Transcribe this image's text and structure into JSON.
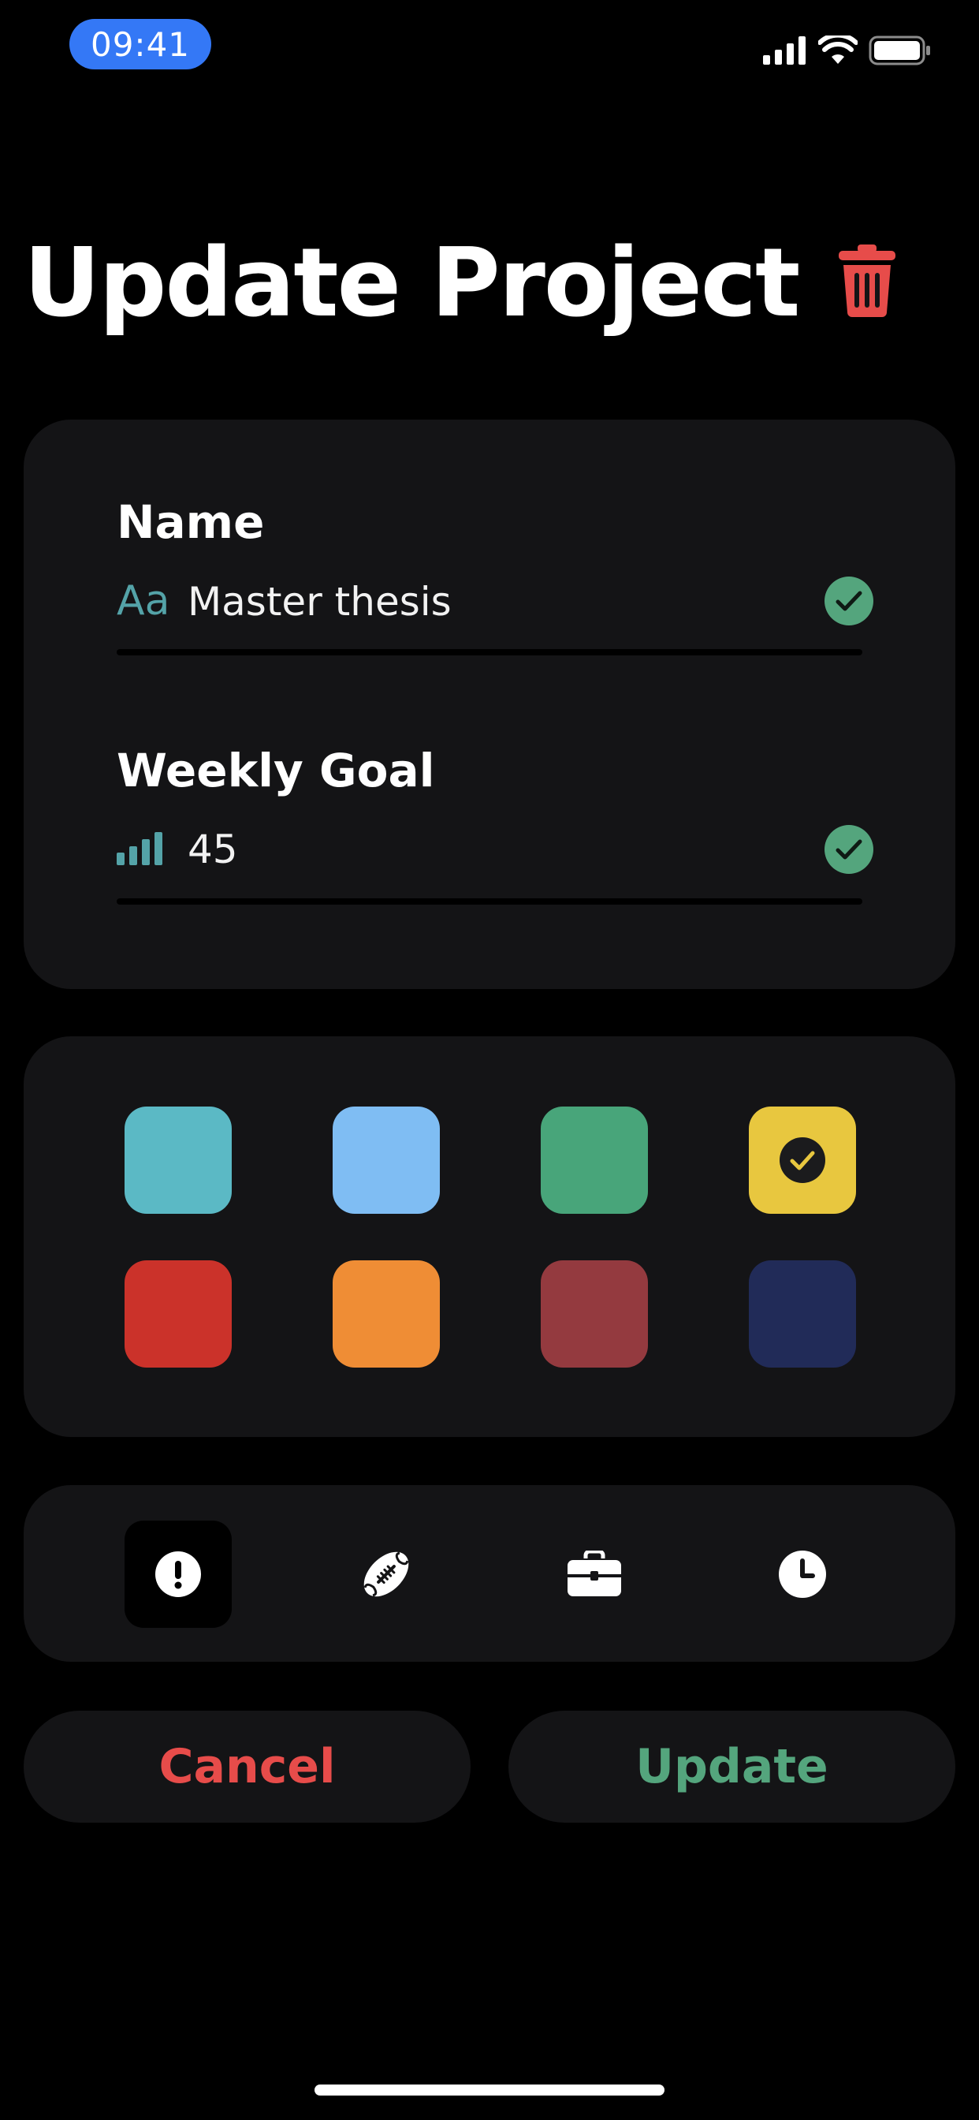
{
  "status_bar": {
    "time": "09:41",
    "signal_icon": "cellular-signal-icon",
    "wifi_icon": "wifi-icon",
    "battery_icon": "battery-icon"
  },
  "header": {
    "title": "Update Project",
    "delete_icon": "trash-icon"
  },
  "form": {
    "name": {
      "label": "Name",
      "icon": "text-aa-icon",
      "icon_text": "Aa",
      "value": "Master thesis",
      "valid_icon": "checkmark-circle-icon"
    },
    "weekly_goal": {
      "label": "Weekly Goal",
      "icon": "bar-chart-icon",
      "value": "45",
      "valid_icon": "checkmark-circle-icon"
    }
  },
  "colors": {
    "options": [
      "#5bb9c5",
      "#7fbdf3",
      "#48a57a",
      "#e8c73f",
      "#cb322a",
      "#ef8d35",
      "#943a3f",
      "#212b58"
    ],
    "selected_index": 3,
    "accent_teal": "#54a3a8",
    "valid_green": "#54a57d",
    "danger_red": "#e74c4a"
  },
  "icons": {
    "options": [
      "exclamation-circle-icon",
      "football-icon",
      "briefcase-icon",
      "clock-icon"
    ],
    "selected_index": 0
  },
  "actions": {
    "cancel_label": "Cancel",
    "update_label": "Update"
  }
}
